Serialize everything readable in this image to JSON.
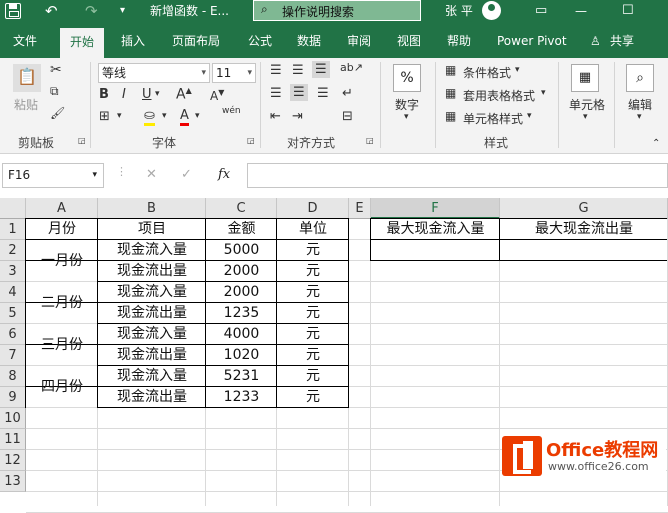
{
  "titlebar": {
    "doc_title": "新增函数 - E...",
    "search_placeholder": "操作说明搜索",
    "user": "张 平"
  },
  "tabs": [
    "文件",
    "开始",
    "插入",
    "页面布局",
    "公式",
    "数据",
    "审阅",
    "视图",
    "帮助",
    "Power Pivot",
    "共享"
  ],
  "ribbon": {
    "clipboard": {
      "paste": "粘贴",
      "label": "剪贴板"
    },
    "font": {
      "name": "等线",
      "size": "11",
      "label": "字体",
      "bold": "B",
      "italic": "I",
      "underline": "U",
      "font_color": "A",
      "pinyin": "wén"
    },
    "alignment": {
      "label": "对齐方式"
    },
    "number": {
      "btn": "数字",
      "pct": "%"
    },
    "styles": {
      "cond": "条件格式",
      "table": "套用表格格式",
      "cell": "单元格样式",
      "label": "样式"
    },
    "cells": {
      "btn": "单元格"
    },
    "edit": {
      "btn": "编辑"
    }
  },
  "formula": {
    "namebox": "F16",
    "fx": "fx",
    "cancel": "✕",
    "enter": "✓",
    "value": ""
  },
  "columns": [
    "A",
    "B",
    "C",
    "D",
    "E",
    "F",
    "G"
  ],
  "rows": [
    "1",
    "2",
    "3",
    "4",
    "5",
    "6",
    "7",
    "8",
    "9",
    "10",
    "11",
    "12",
    "13"
  ],
  "table": {
    "header": [
      "月份",
      "项目",
      "金额",
      "单位"
    ],
    "months": [
      "一月份",
      "二月份",
      "三月份",
      "四月份"
    ],
    "items": [
      "现金流入量",
      "现金流出量",
      "现金流入量",
      "现金流出量",
      "现金流入量",
      "现金流出量",
      "现金流入量",
      "现金流出量"
    ],
    "amounts": [
      "5000",
      "2000",
      "2000",
      "1235",
      "4000",
      "1020",
      "5231",
      "1233"
    ],
    "units": [
      "元",
      "元",
      "元",
      "元",
      "元",
      "元",
      "元",
      "元"
    ]
  },
  "side_headers": {
    "f": "最大现金流入量",
    "g": "最大现金流出量"
  },
  "watermark": {
    "brand": "Office教程网",
    "url": "www.office26.com"
  }
}
